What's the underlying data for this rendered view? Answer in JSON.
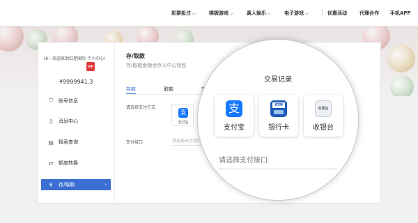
{
  "nav": {
    "items": [
      {
        "label": "彩票投注",
        "chevron": true
      },
      {
        "label": "棋牌游戏",
        "chevron": true
      },
      {
        "label": "真人娱乐",
        "chevron": true
      },
      {
        "label": "电子游戏",
        "chevron": true
      },
      {
        "label": "优惠活动",
        "chevron": false
      },
      {
        "label": "代理合作",
        "chevron": false
      },
      {
        "label": "手机APP",
        "chevron": false
      }
    ]
  },
  "user": {
    "greeting": "Hi！欢迎来到红星国际 个人中心!",
    "vip_badge": "VIP",
    "balance": "¥9999941.3"
  },
  "sidebar": {
    "items": [
      {
        "label": "账号信息",
        "icon": "shield-icon",
        "glyph": "⛉"
      },
      {
        "label": "消息中心",
        "icon": "bell-icon",
        "glyph": "♫"
      },
      {
        "label": "报表查询",
        "icon": "document-icon",
        "glyph": "▤"
      },
      {
        "label": "额度转换",
        "icon": "transfer-icon",
        "glyph": "⇄"
      }
    ],
    "active": {
      "label": "存/取款",
      "icon": "yen-icon",
      "glyph": "¥",
      "arrow": "›"
    }
  },
  "main": {
    "title": "存/取款",
    "subtitle": "存/取款金额会存入中心钱包",
    "tabs": [
      {
        "label": "存款",
        "active": true
      },
      {
        "label": "取款",
        "active": false
      },
      {
        "label": "交",
        "active": false
      }
    ],
    "payment_method_label": "请选择支付方式",
    "payment_interface_label": "支付接口",
    "small_card_label": "支付宝",
    "small_interface_placeholder": "请选择支付接口"
  },
  "magnifier": {
    "title": "交易记录",
    "cards": [
      {
        "label": "支付宝",
        "icon": "alipay-icon",
        "glyph": "支"
      },
      {
        "label": "银行卡",
        "icon": "atm-icon",
        "glyph": "ATM"
      },
      {
        "label": "收银台",
        "icon": "cashier-icon",
        "glyph": "收银台"
      }
    ],
    "interface_placeholder": "请选择支付接口"
  },
  "colors": {
    "accent": "#3b6fd4",
    "alipay": "#1677ff",
    "vip": "#e03a3a"
  }
}
